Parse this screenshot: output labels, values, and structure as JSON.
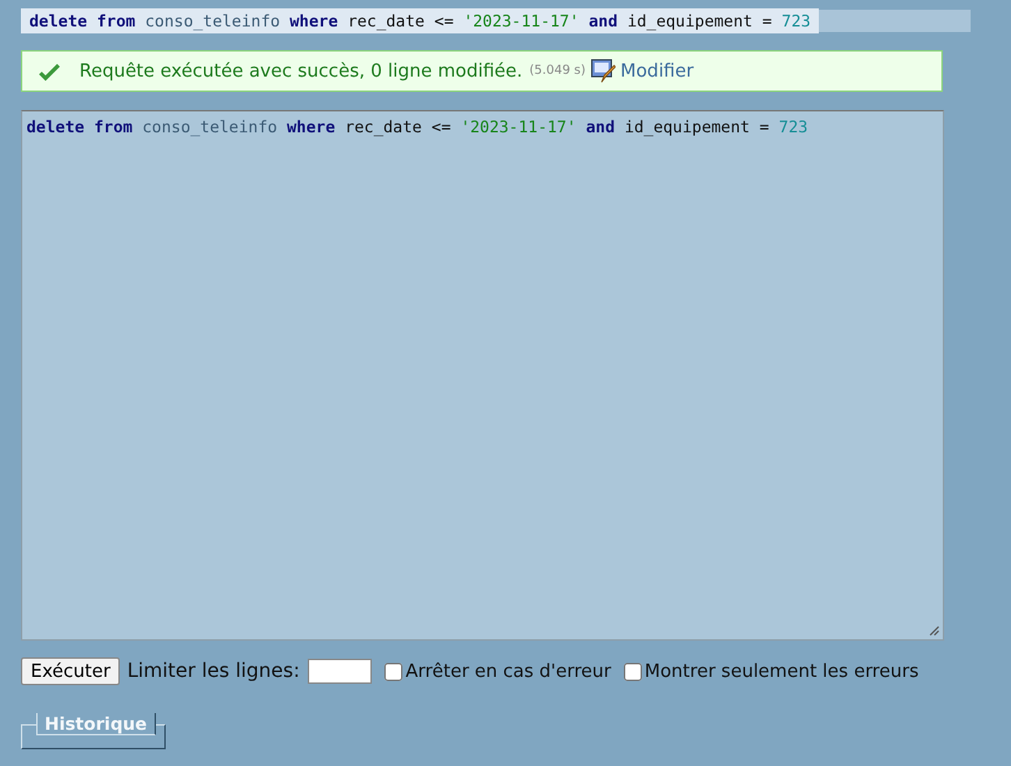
{
  "query_banner": {
    "tokens": [
      {
        "kind": "keyword",
        "text": "delete"
      },
      {
        "kind": "keyword",
        "text": "from"
      },
      {
        "kind": "ident",
        "text": "conso_teleinfo"
      },
      {
        "kind": "keyword",
        "text": "where"
      },
      {
        "kind": "plain",
        "text": "rec_date"
      },
      {
        "kind": "plain",
        "text": "<="
      },
      {
        "kind": "string",
        "text": "'2023-11-17'"
      },
      {
        "kind": "keyword",
        "text": "and"
      },
      {
        "kind": "plain",
        "text": "id_equipement"
      },
      {
        "kind": "plain",
        "text": "="
      },
      {
        "kind": "number",
        "text": "723"
      }
    ]
  },
  "message": {
    "kind": "success",
    "text": "Requête exécutée avec succès, 0 ligne modifiée.",
    "time": "(5.049 s)",
    "edit_link": "Modifier"
  },
  "editor": {
    "tokens": [
      {
        "kind": "keyword",
        "text": "delete"
      },
      {
        "kind": "keyword",
        "text": "from"
      },
      {
        "kind": "ident",
        "text": "conso_teleinfo"
      },
      {
        "kind": "keyword",
        "text": "where"
      },
      {
        "kind": "plain",
        "text": "rec_date"
      },
      {
        "kind": "plain",
        "text": "<="
      },
      {
        "kind": "string",
        "text": "'2023-11-17'"
      },
      {
        "kind": "keyword",
        "text": "and"
      },
      {
        "kind": "plain",
        "text": "id_equipement"
      },
      {
        "kind": "plain",
        "text": "="
      },
      {
        "kind": "number",
        "text": "723"
      }
    ]
  },
  "controls": {
    "execute_button": "Exécuter",
    "limit_label": "Limiter les lignes:",
    "checkboxes": [
      {
        "label": "Arrêter en cas d'erreur",
        "checked": false
      },
      {
        "label": "Montrer seulement les erreurs",
        "checked": false
      }
    ]
  },
  "history": {
    "legend": "Historique"
  }
}
